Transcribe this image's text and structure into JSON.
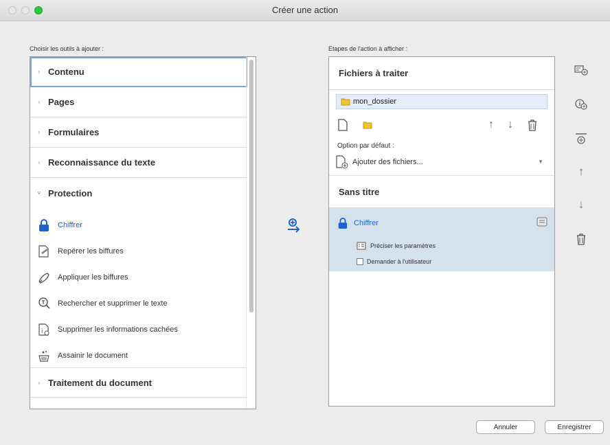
{
  "window": {
    "title": "Créer une action"
  },
  "left": {
    "label": "Choisir les outils à ajouter :",
    "groups_top": [
      {
        "label": "Contenu",
        "chevron": "›"
      },
      {
        "label": "Pages",
        "chevron": "›"
      },
      {
        "label": "Formulaires",
        "chevron": "›"
      },
      {
        "label": "Reconnaissance du texte",
        "chevron": "›"
      },
      {
        "label": "Protection",
        "chevron": "˅"
      }
    ],
    "tools": [
      {
        "label": "Chiffrer",
        "icon": "lock-icon"
      },
      {
        "label": "Repérer les biffures",
        "icon": "mark-redaction-icon"
      },
      {
        "label": "Appliquer les biffures",
        "icon": "apply-redaction-icon"
      },
      {
        "label": "Rechercher et supprimer le texte",
        "icon": "search-remove-text-icon"
      },
      {
        "label": "Supprimer les informations cachées",
        "icon": "remove-hidden-info-icon"
      },
      {
        "label": "Assainir le document",
        "icon": "sanitize-document-icon"
      }
    ],
    "groups_bottom": [
      {
        "label": "Traitement du document",
        "chevron": "›"
      }
    ]
  },
  "right": {
    "label": "Etapes de l'action à afficher :",
    "files_header": "Fichiers à traiter",
    "folder_name": "mon_dossier",
    "default_option_label": "Option par défaut :",
    "add_files_label": "Ajouter des fichiers...",
    "untitled_label": "Sans titre",
    "step": {
      "title": "Chiffrer",
      "params_label": "Préciser les paramètres",
      "ask_user_label": "Demander à l'utilisateur"
    }
  },
  "buttons": {
    "cancel": "Annuler",
    "save": "Enregistrer"
  },
  "colors": {
    "accent": "#1f62c9",
    "selected_step_bg": "#d4e2ee",
    "folder_highlight": "#e4edf9"
  }
}
